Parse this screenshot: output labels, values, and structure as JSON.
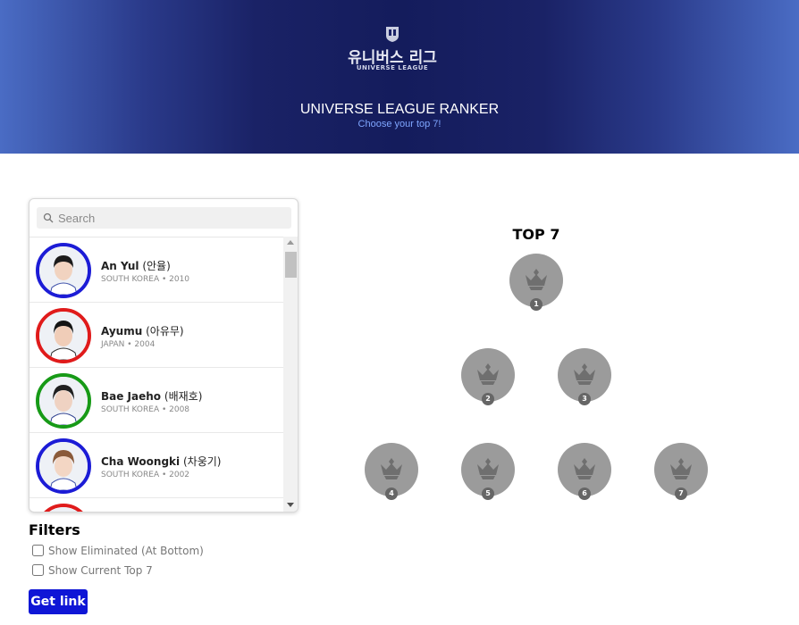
{
  "header": {
    "logo_korean": "유니버스 리그",
    "logo_english": "UNIVERSE LEAGUE",
    "title": "UNIVERSE LEAGUE RANKER",
    "subtitle": "Choose your top 7!"
  },
  "search": {
    "placeholder": "Search",
    "value": ""
  },
  "contestants": [
    {
      "name": "An Yul",
      "korean": "(안율)",
      "country": "SOUTH KOREA",
      "year": "2010",
      "meta": "SOUTH KOREA • 2010",
      "ring_color": "#1c1cd6"
    },
    {
      "name": "Ayumu",
      "korean": "(아유무)",
      "country": "JAPAN",
      "year": "2004",
      "meta": "JAPAN • 2004",
      "ring_color": "#e01b1b"
    },
    {
      "name": "Bae Jaeho",
      "korean": "(배재호)",
      "country": "SOUTH KOREA",
      "year": "2008",
      "meta": "SOUTH KOREA • 2008",
      "ring_color": "#179a17"
    },
    {
      "name": "Cha Woongki",
      "korean": "(차웅기)",
      "country": "SOUTH KOREA",
      "year": "2002",
      "meta": "SOUTH KOREA • 2002",
      "ring_color": "#1c1cd6"
    },
    {
      "name": "",
      "korean": "",
      "country": "",
      "year": "",
      "meta": "",
      "ring_color": "#e01b1b"
    }
  ],
  "filters": {
    "title": "Filters",
    "show_eliminated": {
      "label": "Show Eliminated (At Bottom)",
      "checked": false
    },
    "show_current_top7": {
      "label": "Show Current Top 7",
      "checked": false
    }
  },
  "get_link_label": "Get link",
  "top7": {
    "title": "TOP 7",
    "slots": [
      "1",
      "2",
      "3",
      "4",
      "5",
      "6",
      "7"
    ],
    "empty_slot_icon": "crown-icon",
    "slot_color": "#9b9b9b"
  }
}
